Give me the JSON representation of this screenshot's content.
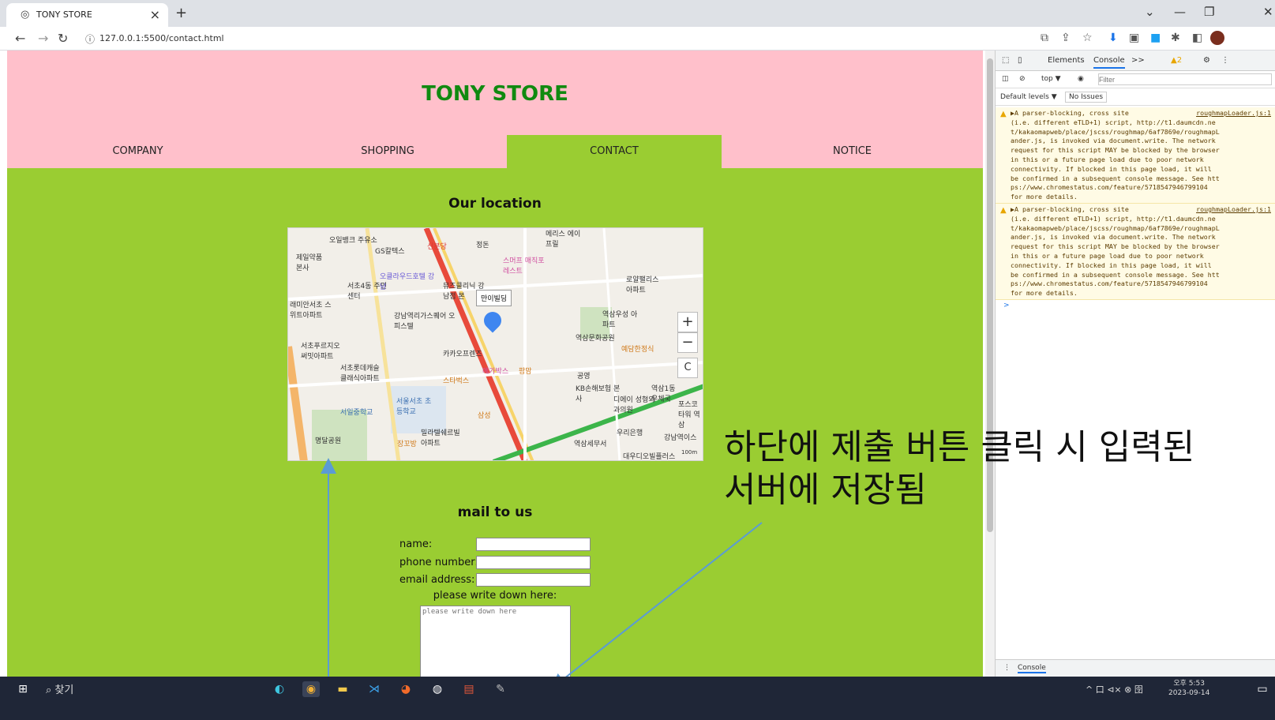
{
  "browser": {
    "tab_title": "TONY STORE",
    "tab_close": "×",
    "new_tab": "+",
    "url": "127.0.0.1:5500/contact.html",
    "window_controls": [
      "⌄",
      "—",
      "❐",
      "✕"
    ]
  },
  "site": {
    "store_title": "TONY STORE",
    "nav": [
      {
        "label": "COMPANY",
        "active": false
      },
      {
        "label": "SHOPPING",
        "active": false
      },
      {
        "label": "CONTACT",
        "active": true
      },
      {
        "label": "NOTICE",
        "active": false
      }
    ],
    "location_title": "Our location",
    "map": {
      "pin_label": "만이빌딩",
      "labels": [
        "오일뱅크 주유소",
        "GS칼텍스",
        "제일약품 본사",
        "신분당",
        "정돈",
        "메리스 에이프릴",
        "스머프 매직포레스트",
        "서초4동 주민센터",
        "오클라우드호텔 강남",
        "뮤즈클리닉 강남점 본",
        "로얄팰리스 아파트",
        "래미안서초 스위트아파트",
        "강남역리가스퀘어 오피스텔",
        "역삼우성 아파트",
        "서초푸르지오 써밋아파트",
        "역삼문화공원",
        "예담한정식",
        "카카오프렌즈",
        "서초롯데캐슬 클래식아파트",
        "메가박스",
        "팜맘",
        "스타벅스",
        "공영",
        "KB손해보험 본사",
        "디에이 성형외과의원",
        "역삼1동 우체국",
        "서울서초 초등학교",
        "서일중학교",
        "삼성",
        "포스코 타워 역삼",
        "밀라텔쉐르빌 아파트",
        "우리은행",
        "강남역이스",
        "명달공원",
        "장꼬방",
        "역삼세무서",
        "대우디오빌플러스",
        "100m"
      ],
      "zoom_in": "+",
      "zoom_out": "−",
      "refresh": "C"
    },
    "mail_title": "mail to us",
    "form": {
      "name_label": "name:",
      "phone_label": "phone number:",
      "email_label": "email address:",
      "message_label": "please write down here:",
      "message_placeholder": "please write down here"
    }
  },
  "annotation": {
    "text": "하단에 제출 버튼 클릭 시 입력된\n서버에 저장됨"
  },
  "devtools": {
    "tabs": [
      "Elements",
      "Console",
      ">>"
    ],
    "active_tab": "Console",
    "warning_count": "2",
    "context": "top ▼",
    "filter_placeholder": "Filter",
    "levels": "Default levels ▼",
    "issues": "No Issues",
    "warnings": [
      {
        "source": "roughmapLoader.js:1",
        "text": "▶A parser-blocking, cross site\n(i.e. different eTLD+1) script, http://t1.daumcdn.ne\nt/kakaomapweb/place/jscss/roughmap/6af7869e/roughmapL\nander.js, is invoked via document.write. The network\nrequest for this script MAY be blocked by the browser\nin this or a future page load due to poor network\nconnectivity. If blocked in this page load, it will\nbe confirmed in a subsequent console message. See htt\nps://www.chromestatus.com/feature/5718547946799104\nfor more details."
      },
      {
        "source": "roughmapLoader.js:1",
        "text": "▶A parser-blocking, cross site\n(i.e. different eTLD+1) script, http://t1.daumcdn.ne\nt/kakaomapweb/place/jscss/roughmap/6af7869e/roughmapL\nander.js, is invoked via document.write. The network\nrequest for this script MAY be blocked by the browser\nin this or a future page load due to poor network\nconnectivity. If blocked in this page load, it will\nbe confirmed in a subsequent console message. See htt\nps://www.chromestatus.com/feature/5718547946799104\nfor more details."
      }
    ],
    "prompt": ">",
    "drawer_tab": "Console"
  },
  "taskbar": {
    "search_label": "찾기",
    "tray": "^ 口 ⊲× ⊗ 囹",
    "time": "오후 5:53",
    "date": "2023-09-14"
  },
  "colors": {
    "header_pink": "#ffc0cb",
    "body_green": "#9acd32",
    "title_green": "#108a10",
    "taskbar": "#1f2637",
    "arrow": "#5b9bd5"
  }
}
